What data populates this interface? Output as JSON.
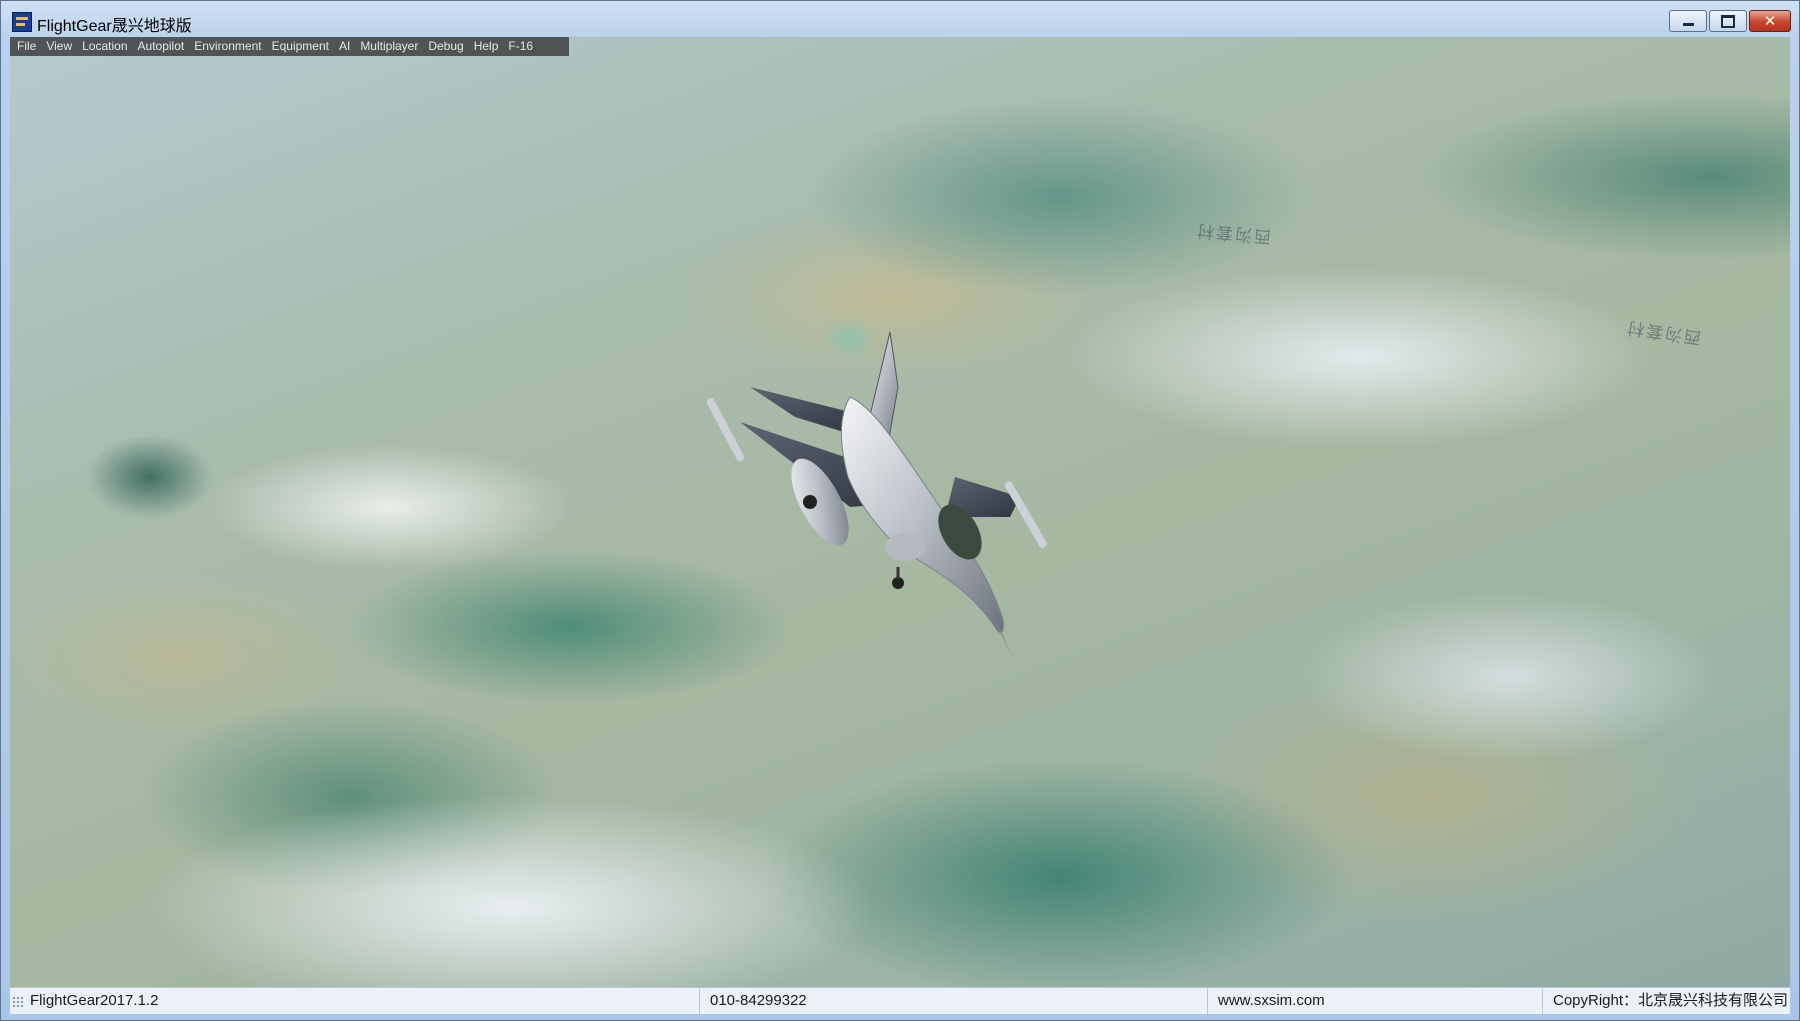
{
  "window": {
    "title": "FlightGear晟兴地球版",
    "minimize_glyph": "",
    "maximize_glyph": "",
    "close_glyph": "✕"
  },
  "menu": {
    "items": [
      {
        "label": "File"
      },
      {
        "label": "View"
      },
      {
        "label": "Location"
      },
      {
        "label": "Autopilot"
      },
      {
        "label": "Environment"
      },
      {
        "label": "Equipment"
      },
      {
        "label": "AI"
      },
      {
        "label": "Multiplayer"
      },
      {
        "label": "Debug"
      },
      {
        "label": "Help"
      },
      {
        "label": "F-16"
      }
    ]
  },
  "map_labels": [
    "西沟套村",
    "西沟套村"
  ],
  "statusbar": {
    "app_version": "FlightGear2017.1.2",
    "phone": "010-84299322",
    "website": "www.sxsim.com",
    "copyright": "CopyRight：北京晟兴科技有限公司"
  },
  "icons": {
    "app": "flightgear-app-icon",
    "minimize": "minimize-icon",
    "maximize": "maximize-icon",
    "close": "close-icon",
    "grip": "resize-grip-icon"
  },
  "colors": {
    "titlebar": "#b9d1ec",
    "close_button": "#c7452b",
    "menubar_bg": "#282828",
    "statusbar_bg": "#ecf1f8"
  }
}
